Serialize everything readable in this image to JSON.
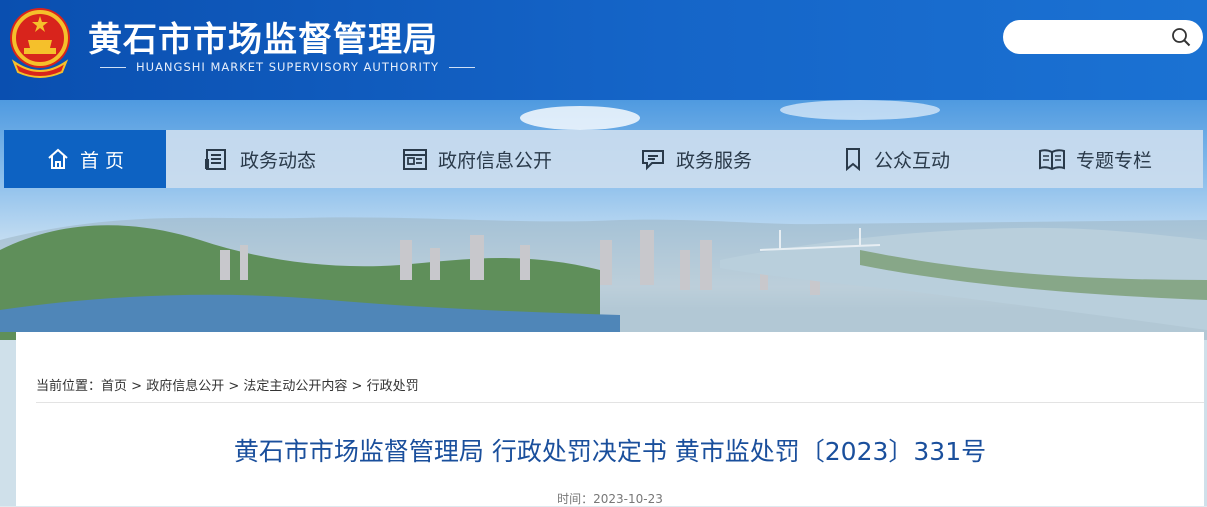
{
  "header": {
    "title": "黄石市市场监督管理局",
    "subtitle": "HUANGSHI MARKET SUPERVISORY AUTHORITY",
    "search_placeholder": ""
  },
  "nav": {
    "items": [
      {
        "label": "首 页",
        "icon": "home-icon"
      },
      {
        "label": "政务动态",
        "icon": "news-icon"
      },
      {
        "label": "政府信息公开",
        "icon": "info-icon"
      },
      {
        "label": "政务服务",
        "icon": "service-chat-icon"
      },
      {
        "label": "公众互动",
        "icon": "bookmark-icon"
      },
      {
        "label": "专题专栏",
        "icon": "book-icon"
      }
    ]
  },
  "breadcrumb": {
    "prefix": "当前位置：",
    "items": [
      "首页",
      "政府信息公开",
      "法定主动公开内容",
      "行政处罚"
    ],
    "separator": " > "
  },
  "article": {
    "title": "黄石市市场监督管理局 行政处罚决定书 黄市监处罚〔2023〕331号",
    "date": "时间：2023-10-23"
  },
  "colors": {
    "header_blue": "#0a4fb0",
    "nav_active": "#0d62c2",
    "title_blue": "#1a4f9c"
  }
}
